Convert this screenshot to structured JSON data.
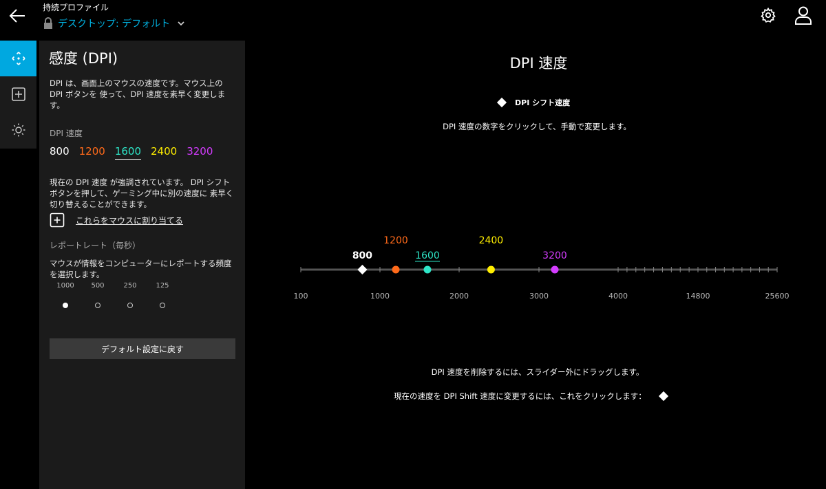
{
  "header": {
    "profile_label": "持続プロファイル",
    "profile_name": "デスクトップ: デフォルト"
  },
  "panel": {
    "title": "感度 (DPI)",
    "description": "DPI は、画面上のマウスの速度です。マウス上の DPI ボタンを 使って、DPI 速度を素早く変更します。",
    "dpi_speeds_label": "DPI 速度",
    "dpi_values": [
      {
        "label": "800",
        "color": "#ffffff"
      },
      {
        "label": "1200",
        "color": "#ff6a1a"
      },
      {
        "label": "1600",
        "color": "#2ee6c8"
      },
      {
        "label": "2400",
        "color": "#ffee00"
      },
      {
        "label": "3200",
        "color": "#d43cff"
      }
    ],
    "current_note": "現在の DPI 速度 が強調されています。 DPI シフト ボタンを押して、ゲーミング中に別の速度に 素早く切り替えることができます。",
    "assign_text": "これらをマウスに割り当てる",
    "report_rate_label": "レポートレート（毎秒）",
    "report_rate_desc": "マウスが情報をコンピューターにレポートする頻度を選択します。",
    "report_rates": [
      "1000",
      "500",
      "250",
      "125"
    ],
    "report_rate_selected": "1000",
    "reset_label": "デフォルト設定に戻す"
  },
  "main": {
    "title": "DPI 速度",
    "legend": "DPI シフト速度",
    "instruction": "DPI 速度の数字をクリックして、手動で変更します。",
    "hint_delete": "DPI 速度を削除するには、スライダー外にドラッグします。",
    "hint_shift": "現在の速度を DPI Shift 速度に変更するには、これをクリックします："
  },
  "slider": {
    "axis_labels": [
      "100",
      "1000",
      "2000",
      "3000",
      "4000",
      "14800",
      "25600"
    ],
    "markers": [
      {
        "value": 800,
        "label": "800",
        "color": "#ffffff",
        "shape": "diamond",
        "dpi_shift": true
      },
      {
        "value": 1200,
        "label": "1200",
        "color": "#ff6a1a",
        "shape": "circle"
      },
      {
        "value": 1600,
        "label": "1600",
        "color": "#2ee6c8",
        "shape": "circle",
        "current": true
      },
      {
        "value": 2400,
        "label": "2400",
        "color": "#ffee00",
        "shape": "circle"
      },
      {
        "value": 3200,
        "label": "3200",
        "color": "#d43cff",
        "shape": "circle"
      }
    ]
  },
  "icons": {
    "back": "back-arrow-icon",
    "lock": "lock-icon",
    "chevron": "chevron-down-icon",
    "gear": "gear-icon",
    "user": "user-icon",
    "rail": [
      "move-icon",
      "add-box-icon",
      "brightness-icon"
    ]
  },
  "colors": {
    "accent": "#00a8e0",
    "panel_bg": "#1b1b1b"
  }
}
